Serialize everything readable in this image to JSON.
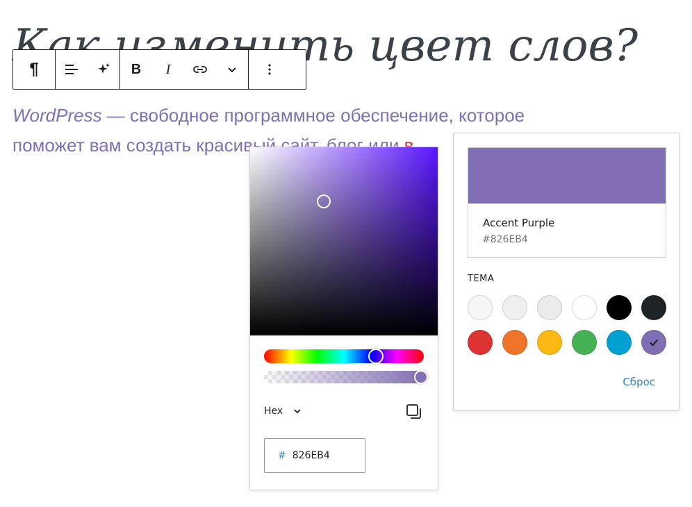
{
  "heading": "Как изменить цвет слов?",
  "toolbar": {
    "paragraph_icon": "pilcrow-icon",
    "bold": "B",
    "italic": "I"
  },
  "paragraph": {
    "part1": "WordPress",
    "part2": " — свободное программное обеспечение, которое поможет вам создать красивый сайт, блог или ",
    "part3": "в"
  },
  "palette": {
    "selected_name": "Accent Purple",
    "selected_hex": "#826EB4",
    "selected_color": "#826eb4",
    "theme_label": "ТЕМА",
    "reset_label": "Сброс",
    "swatches": [
      "#f7f7f7",
      "#f0f0f1",
      "#ebebec",
      "#ffffff",
      "#000000",
      "#1d2327",
      "#dd3333",
      "#f0732a",
      "#fdb913",
      "#44b255",
      "#00a0d2",
      "#826eb4"
    ],
    "selected_index": 11
  },
  "picker": {
    "mode_label": "Hex",
    "hex_prefix": "#",
    "hex_value": "826EB4"
  }
}
